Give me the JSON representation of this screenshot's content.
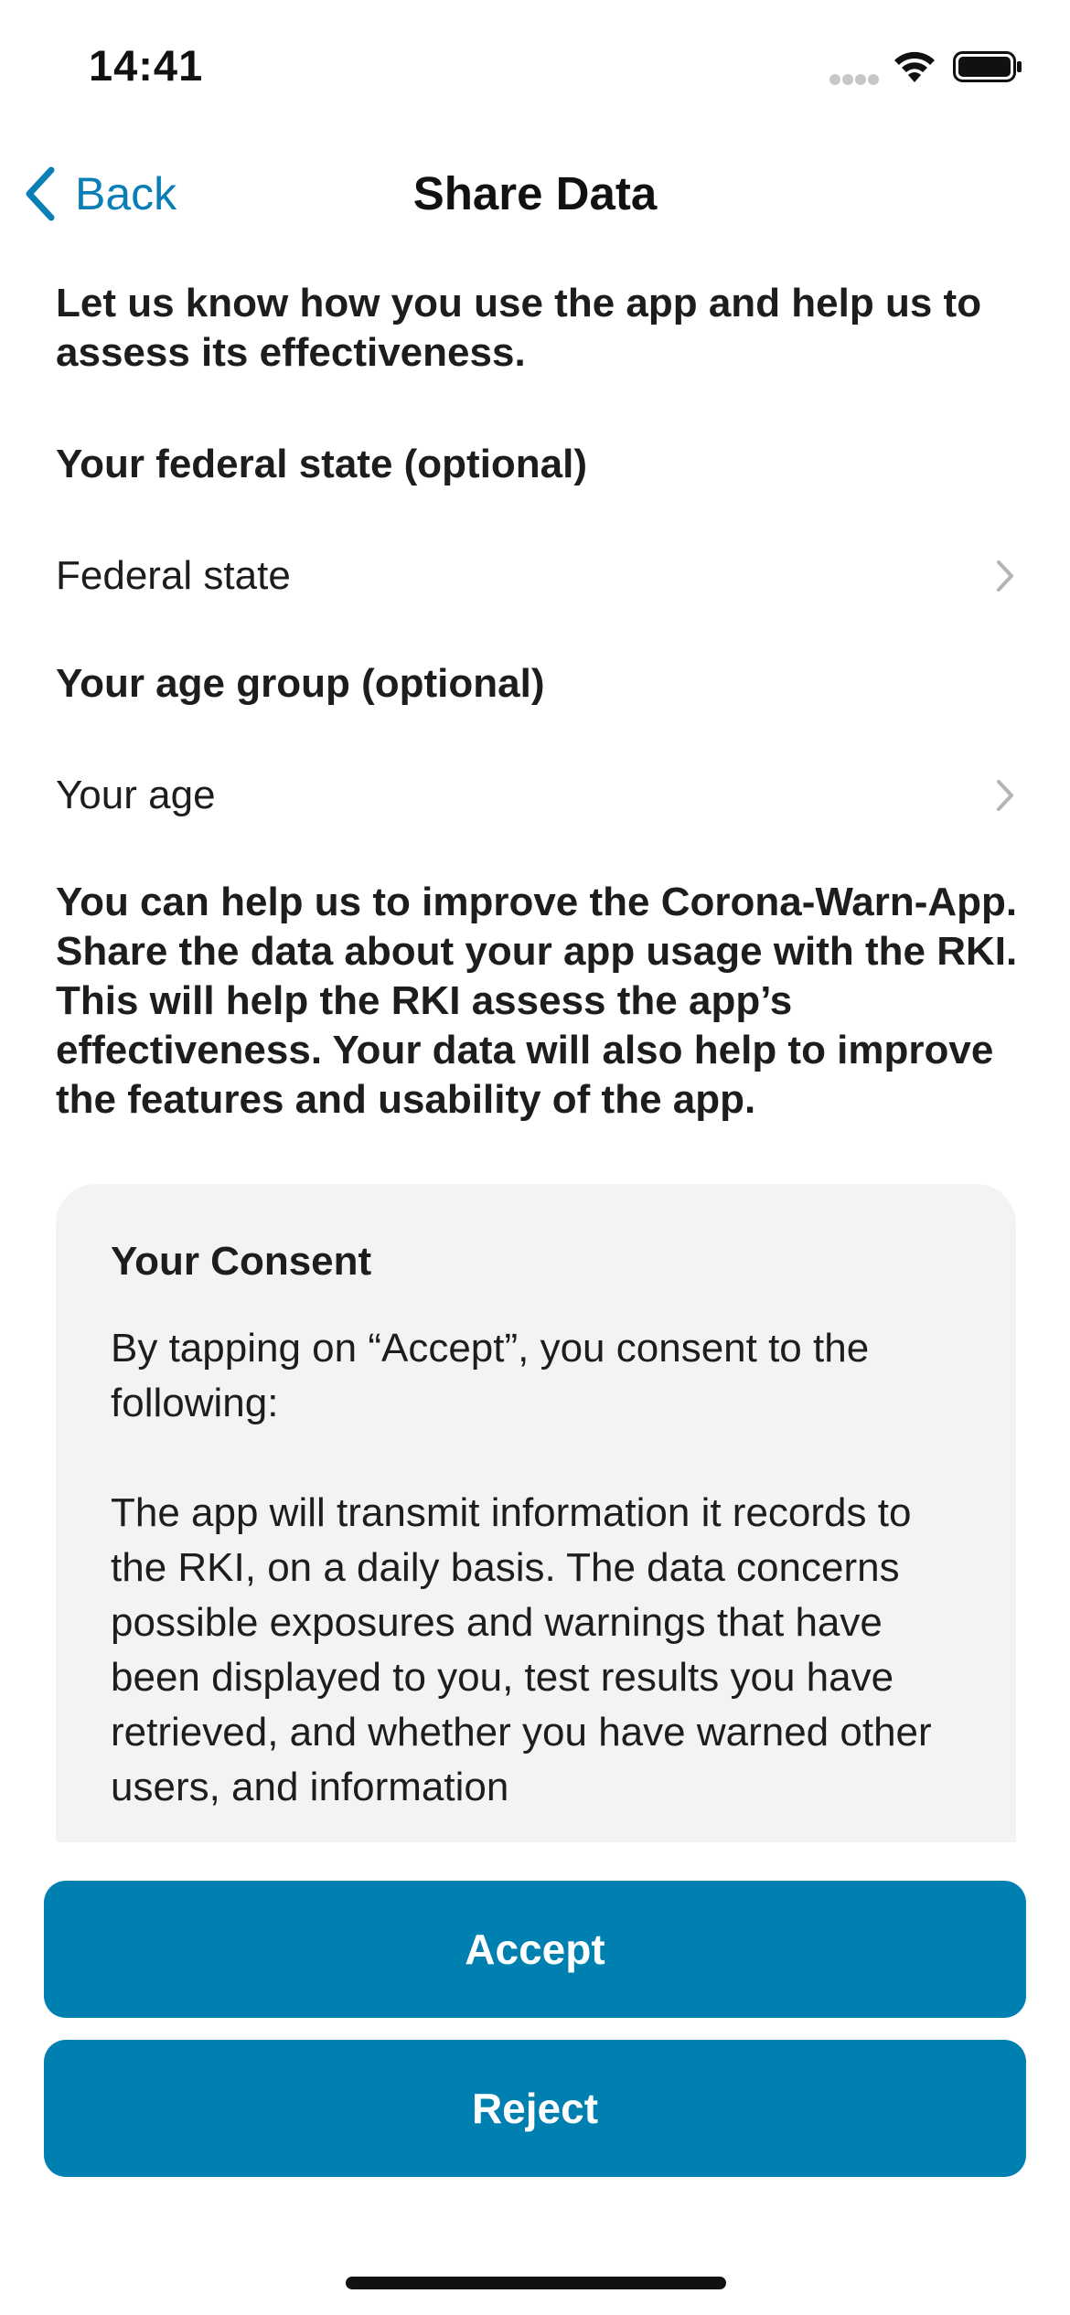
{
  "status_bar": {
    "time": "14:41"
  },
  "nav": {
    "back_label": "Back",
    "title": "Share Data"
  },
  "intro": "Let us know how you use the app and help us to assess its effectiveness.",
  "federal_state": {
    "heading": "Your federal state (optional)",
    "placeholder": "Federal state"
  },
  "age_group": {
    "heading": "Your age group (optional)",
    "placeholder": "Your age"
  },
  "info": "You can help us to improve the Corona-Warn-App. Share the data about your app usage with the RKI. This will help the RKI assess the app’s effectiveness. Your data will also help to improve the features and usability of the app.",
  "consent": {
    "title": "Your Consent",
    "paragraph_1": "By tapping on “Accept”, you consent to the following:",
    "paragraph_2": "The app will transmit information it records to the RKI, on a daily basis. The data concerns possible exposures and warnings that have been displayed to you, test results you have retrieved, and whether you have warned other users, and information"
  },
  "buttons": {
    "accept": "Accept",
    "reject": "Reject"
  },
  "colors": {
    "accent": "#0a7fb5",
    "button": "#0080b0",
    "card_background": "#f3f3f3"
  },
  "icons": {
    "back": "chevron-left-icon",
    "row_disclosure": "chevron-right-icon",
    "signal": "cellular-signal-icon",
    "wifi": "wifi-icon",
    "battery": "battery-icon"
  }
}
